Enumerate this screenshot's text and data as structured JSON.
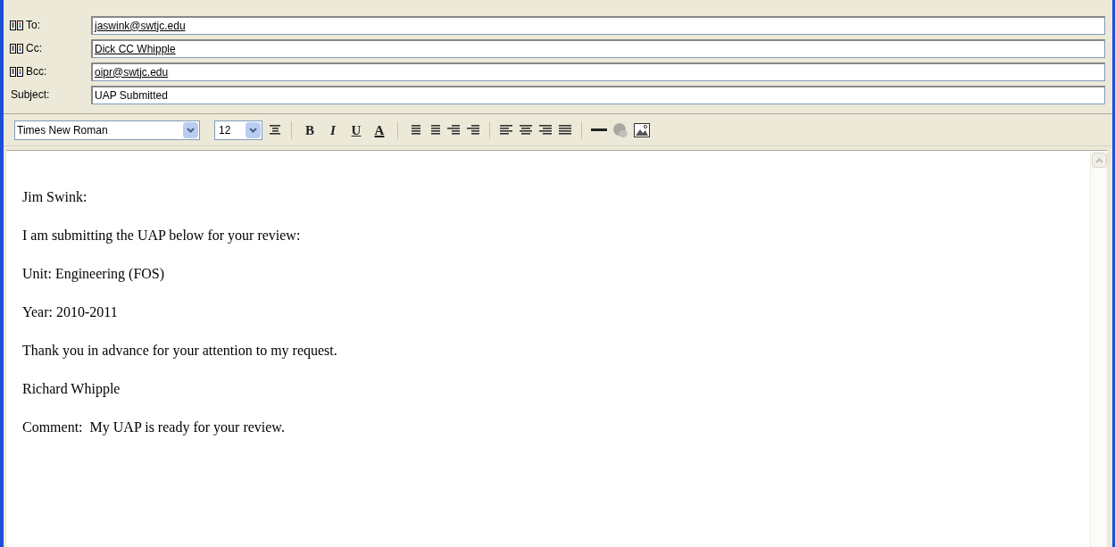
{
  "header_fields": [
    {
      "kind": "recipient",
      "label": "To:",
      "value": "jaswink@swtjc.edu"
    },
    {
      "kind": "recipient",
      "label": "Cc:",
      "value": "Dick CC Whipple"
    },
    {
      "kind": "recipient",
      "label": "Bcc:",
      "value": "oipr@swtjc.edu"
    },
    {
      "kind": "plain",
      "label": "Subject:",
      "value": "UAP Submitted"
    }
  ],
  "toolbar": {
    "font": "Times New Roman",
    "size": "12",
    "format_buttons": [
      "B",
      "I",
      "U",
      "A"
    ]
  },
  "body": [
    "Jim Swink:",
    "I am submitting the UAP below for your review:",
    "Unit: Engineering (FOS)",
    "Year: 2010-2011",
    "Thank you in advance for your attention to my request.",
    "Richard Whipple",
    "Comment:  My UAP is ready for your review."
  ]
}
